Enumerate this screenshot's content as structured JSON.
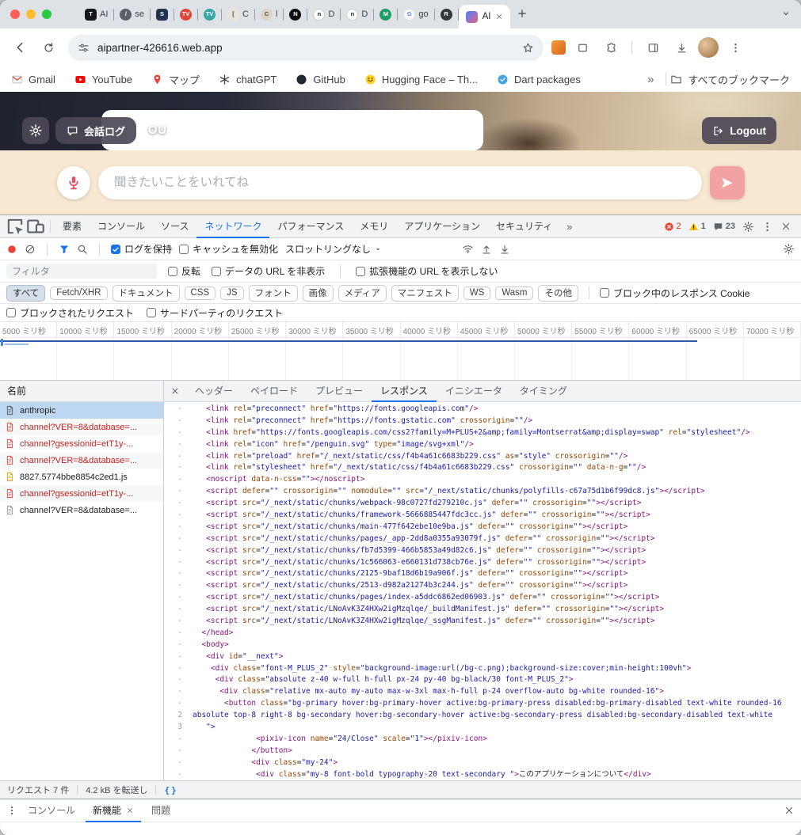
{
  "colors": {
    "accent": "#1a73e8",
    "error": "#d93025",
    "warning": "#fbbc04",
    "peach": "#f8e8d2",
    "send_button": "#f2a2a2",
    "mic": "#e25568",
    "selected_row": "#bdd7f1",
    "tag": "#881280",
    "attr": "#994500",
    "string": "#1a1aa6"
  },
  "browser": {
    "tabs": [
      {
        "glyph": "T",
        "bg": "#17171b",
        "fg": "#ffffff",
        "shape": "sq",
        "title": "AI"
      },
      {
        "glyph": "/",
        "bg": "#5b6067",
        "fg": "#ffffff",
        "shape": "ci",
        "title": "se"
      },
      {
        "glyph": "S",
        "bg": "#223350",
        "fg": "#ffffff",
        "shape": "sq",
        "title": ""
      },
      {
        "glyph": "TV",
        "bg": "#e04639",
        "fg": "#ffffff",
        "shape": "ci",
        "title": ""
      },
      {
        "glyph": "TV",
        "bg": "#35a6a0",
        "fg": "#ffffff",
        "shape": "ci",
        "title": ""
      },
      {
        "glyph": "[",
        "bg": "#e9e3da",
        "fg": "#4a4a4a",
        "shape": "sq",
        "title": "C"
      },
      {
        "glyph": "C",
        "bg": "#ddd3c6",
        "fg": "#4a4a4a",
        "shape": "ci",
        "title": "l"
      },
      {
        "glyph": "N",
        "bg": "#0d0d0d",
        "fg": "#ffffff",
        "shape": "ci",
        "title": ""
      },
      {
        "glyph": "n",
        "bg": "#ffffff",
        "fg": "#1a1a1a",
        "shape": "ci",
        "border": "#c9c9c9",
        "title": "D"
      },
      {
        "glyph": "n",
        "bg": "#ffffff",
        "fg": "#1a1a1a",
        "shape": "ci",
        "border": "#c9c9c9",
        "title": "D"
      },
      {
        "glyph": "M",
        "bg": "#1d9f62",
        "fg": "#ffffff",
        "shape": "ci",
        "title": ""
      },
      {
        "glyph": "G",
        "bg": "#ffffff",
        "fg": "#4285f4",
        "shape": "ci",
        "border": "#dadce0",
        "title": "go"
      },
      {
        "glyph": "R",
        "bg": "#34373c",
        "fg": "#ffffff",
        "shape": "ci",
        "title": ""
      }
    ],
    "active_tab": {
      "title": "AI"
    },
    "address": "aipartner-426616.web.app",
    "bookmarks": [
      {
        "icon": "gmail",
        "label": "Gmail"
      },
      {
        "icon": "youtube",
        "label": "YouTube"
      },
      {
        "icon": "mappin",
        "label": "マップ"
      },
      {
        "icon": "openai",
        "label": "chatGPT"
      },
      {
        "icon": "github",
        "label": "GitHub"
      },
      {
        "icon": "huggingface",
        "label": "Hugging Face – Th..."
      },
      {
        "icon": "dart",
        "label": "Dart packages"
      }
    ],
    "bookmarks_overflow": "»",
    "all_bookmarks": "すべてのブックマーク"
  },
  "page": {
    "kaiwa_log": "会話ログ",
    "ou": "OU",
    "logout": "Logout",
    "input_placeholder": "聞きたいことをいれてね"
  },
  "devtools": {
    "tabs": [
      "要素",
      "コンソール",
      "ソース",
      "ネットワーク",
      "パフォーマンス",
      "メモリ",
      "アプリケーション",
      "セキュリティ"
    ],
    "active_tab": "ネットワーク",
    "more": "»",
    "badges": {
      "errors": "2",
      "warnings": "1",
      "messages": "23"
    },
    "toolbar": {
      "preserve_log": "ログを保持",
      "disable_cache": "キャッシュを無効化",
      "throttling": "スロットリングなし"
    },
    "filter": {
      "placeholder": "フィルタ",
      "invert": "反転",
      "hide_data_urls": "データの URL を非表示",
      "hide_extension_urls": "拡張機能の URL を表示しない"
    },
    "chips": [
      "すべて",
      "Fetch/XHR",
      "ドキュメント",
      "CSS",
      "JS",
      "フォント",
      "画像",
      "メディア",
      "マニフェスト",
      "WS",
      "Wasm",
      "その他"
    ],
    "chips_active": "すべて",
    "blocked_cookies": "ブロック中のレスポンス Cookie",
    "blocked_requests": "ブロックされたリクエスト",
    "third_party": "サードパーティのリクエスト",
    "timeline_labels": [
      "5000 ミリ秒",
      "10000 ミリ秒",
      "15000 ミリ秒",
      "20000 ミリ秒",
      "25000 ミリ秒",
      "30000 ミリ秒",
      "35000 ミリ秒",
      "40000 ミリ秒",
      "45000 ミリ秒",
      "50000 ミリ秒",
      "55000 ミリ秒",
      "60000 ミリ秒",
      "65000 ミリ秒",
      "70000 ミリ秒"
    ],
    "name_header": "名前",
    "requests": [
      {
        "name": "anthropic",
        "type": "doc",
        "state": "selected"
      },
      {
        "name": "channel?VER=8&database=...",
        "type": "doc-err",
        "state": "error"
      },
      {
        "name": "channel?gsessionid=etT1y-...",
        "type": "doc-err",
        "state": "error"
      },
      {
        "name": "channel?VER=8&database=...",
        "type": "doc-err",
        "state": "error"
      },
      {
        "name": "8827.5774bbe8854c2ed1.js",
        "type": "doc-js",
        "state": "normal"
      },
      {
        "name": "channel?gsessionid=etT1y-...",
        "type": "doc-err",
        "state": "error"
      },
      {
        "name": "channel?VER=8&database=...",
        "type": "doc-plain",
        "state": "normal"
      }
    ],
    "detail_tabs": [
      "ヘッダー",
      "ペイロード",
      "プレビュー",
      "レスポンス",
      "イニシエータ",
      "タイミング"
    ],
    "detail_active": "レスポンス",
    "code_lines": [
      {
        "m": "-",
        "t": "   <link rel=\"preconnect\" href=\"https://fonts.googleapis.com\"/>"
      },
      {
        "m": "-",
        "t": "   <link rel=\"preconnect\" href=\"https://fonts.gstatic.com\" crossorigin=\"\"/>"
      },
      {
        "m": "-",
        "t": "   <link href=\"https://fonts.googleapis.com/css2?family=M+PLUS+2&amp;family=Montserrat&amp;display=swap\" rel=\"stylesheet\"/>"
      },
      {
        "m": "-",
        "t": "   <link rel=\"icon\" href=\"/penguin.svg\" type=\"image/svg+xml\"/>"
      },
      {
        "m": "-",
        "t": "   <link rel=\"preload\" href=\"/_next/static/css/f4b4a61c6683b229.css\" as=\"style\" crossorigin=\"\"/>"
      },
      {
        "m": "-",
        "t": "   <link rel=\"stylesheet\" href=\"/_next/static/css/f4b4a61c6683b229.css\" crossorigin=\"\" data-n-g=\"\"/>"
      },
      {
        "m": "-",
        "t": "   <noscript data-n-css=\"\"></noscript>"
      },
      {
        "m": "-",
        "t": "   <script defer=\"\" crossorigin=\"\" nomodule=\"\" src=\"/_next/static/chunks/polyfills-c67a75d1b6f99dc8.js\"></script>"
      },
      {
        "m": "-",
        "t": "   <script src=\"/_next/static/chunks/webpack-98c0727fd279210c.js\" defer=\"\" crossorigin=\"\"></script>"
      },
      {
        "m": "-",
        "t": "   <script src=\"/_next/static/chunks/framework-5666885447fdc3cc.js\" defer=\"\" crossorigin=\"\"></script>"
      },
      {
        "m": "-",
        "t": "   <script src=\"/_next/static/chunks/main-477f642ebe10e9ba.js\" defer=\"\" crossorigin=\"\"></script>"
      },
      {
        "m": "-",
        "t": "   <script src=\"/_next/static/chunks/pages/_app-2dd8a0355a93079f.js\" defer=\"\" crossorigin=\"\"></script>"
      },
      {
        "m": "-",
        "t": "   <script src=\"/_next/static/chunks/fb7d5399-466b5853a49d82c6.js\" defer=\"\" crossorigin=\"\"></script>"
      },
      {
        "m": "-",
        "t": "   <script src=\"/_next/static/chunks/1c566063-e660131d738cb76e.js\" defer=\"\" crossorigin=\"\"></script>"
      },
      {
        "m": "-",
        "t": "   <script src=\"/_next/static/chunks/2125-9baf18d6b19a906f.js\" defer=\"\" crossorigin=\"\"></script>"
      },
      {
        "m": "-",
        "t": "   <script src=\"/_next/static/chunks/2513-d982a21274b3c244.js\" defer=\"\" crossorigin=\"\"></script>"
      },
      {
        "m": "-",
        "t": "   <script src=\"/_next/static/chunks/pages/index-a5ddc6862ed06903.js\" defer=\"\" crossorigin=\"\"></script>"
      },
      {
        "m": "-",
        "t": "   <script src=\"/_next/static/LNoAvK3Z4HXw2igMzqlqe/_buildManifest.js\" defer=\"\" crossorigin=\"\"></script>"
      },
      {
        "m": "-",
        "t": "   <script src=\"/_next/static/LNoAvK3Z4HXw2igMzqlqe/_ssgManifest.js\" defer=\"\" crossorigin=\"\"></script>"
      },
      {
        "m": "-",
        "t": "  </head>"
      },
      {
        "m": "-",
        "t": "  <body>"
      },
      {
        "m": "-",
        "t": "   <div id=\"__next\">"
      },
      {
        "m": "-",
        "t": "    <div class=\"font-M_PLUS_2\" style=\"background-image:url(/bg-c.png);background-size:cover;min-height:100vh\">"
      },
      {
        "m": "-",
        "t": "     <div class=\"absolute z-40 w-full h-full px-24 py-40 bg-black/30 font-M_PLUS_2\">"
      },
      {
        "m": "-",
        "t": "      <div class=\"relative mx-auto my-auto max-w-3xl max-h-full p-24 overflow-auto bg-white rounded-16\">"
      },
      {
        "m": "-",
        "t": "       <button class=\"bg-primary hover:bg-primary-hover active:bg-primary-press disabled:bg-primary-disabled text-white rounded-16"
      },
      {
        "m": "2",
        "f": "s",
        "t": "absolute top-8 right-8 bg-secondary hover:bg-secondary-hover active:bg-secondary-press disabled:bg-secondary-disabled text-white"
      },
      {
        "m": "3",
        "t": "   \">"
      },
      {
        "m": "-",
        "t": "              <pixiv-icon name=\"24/Close\" scale=\"1\"></pixiv-icon>"
      },
      {
        "m": "-",
        "t": "             </button>"
      },
      {
        "m": "-",
        "t": "             <div class=\"my-24\">"
      },
      {
        "m": "-",
        "t": "              <div class=\"my-8 font-bold typography-20 text-secondary \">このアプリケーションについて</div>"
      }
    ],
    "status": {
      "requests": "リクエスト 7 件",
      "transferred": "4.2 kB を転送し",
      "format": "{}"
    },
    "drawer": {
      "tabs": [
        "コンソール",
        "新機能",
        "問題"
      ],
      "active": "新機能"
    }
  }
}
